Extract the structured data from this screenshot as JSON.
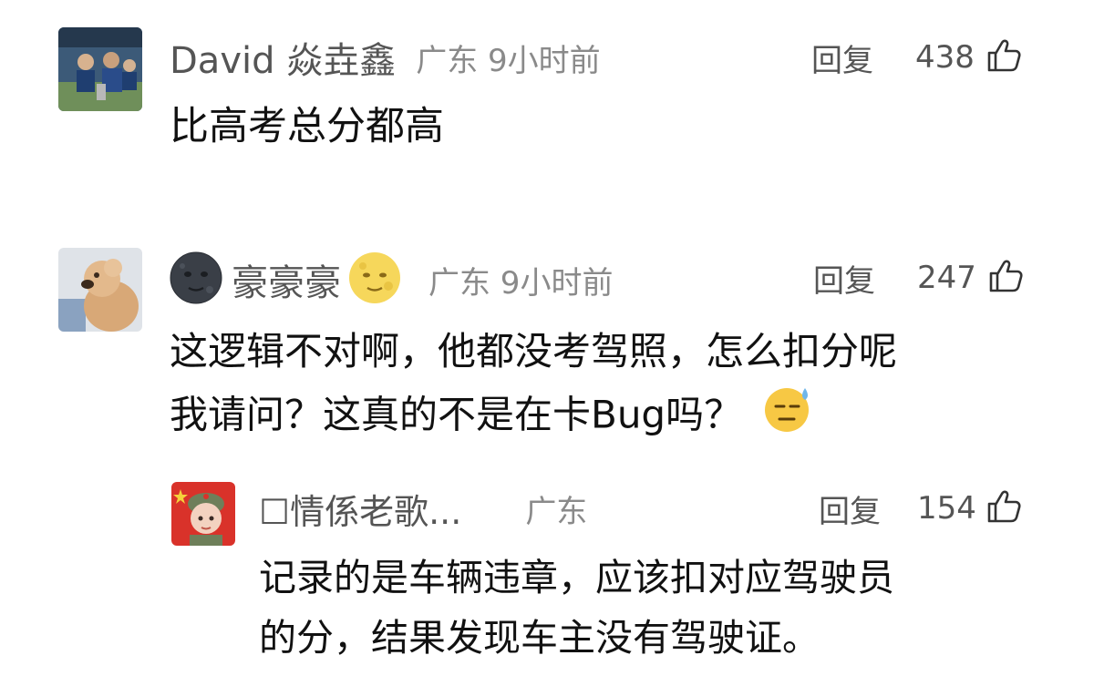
{
  "comments": [
    {
      "username": "David 焱垚鑫",
      "location": "广东 9小时前",
      "reply_label": "回复",
      "likes": "438",
      "text_lines": [
        "比高考总分都高"
      ]
    },
    {
      "username": "豪豪豪",
      "location": "广东 9小时前",
      "reply_label": "回复",
      "likes": "247",
      "text_lines": [
        "这逻辑不对啊，他都没考驾照，怎么扣分呢",
        "我请问？这真的不是在卡Bug吗？"
      ]
    }
  ],
  "replies": [
    {
      "username": "☐情係老歌...",
      "location": "广东",
      "reply_label": "回复",
      "likes": "154",
      "text_lines": [
        "记录的是车辆违章，应该扣对应驾驶员",
        "的分，结果发现车主没有驾驶证。"
      ]
    }
  ],
  "icons": {
    "like": "thumbs-up-icon",
    "new_moon_face": "new-moon-face-emoji",
    "full_moon_face": "full-moon-face-emoji",
    "sweat_face": "downcast-sweat-face-emoji"
  },
  "colors": {
    "username": "#555555",
    "meta": "#8a8a8a",
    "body": "#111111"
  }
}
